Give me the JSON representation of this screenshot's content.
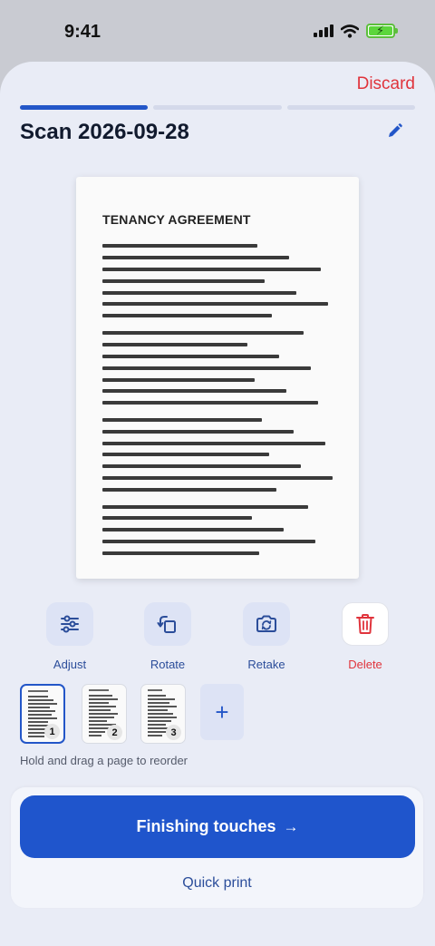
{
  "status_bar": {
    "time": "9:41"
  },
  "header": {
    "discard_label": "Discard",
    "title": "Scan 2026-09-28",
    "progress_steps": [
      {
        "active": true
      },
      {
        "active": false
      },
      {
        "active": false
      }
    ]
  },
  "document": {
    "heading": "TENANCY AGREEMENT"
  },
  "actions": [
    {
      "label": "Adjust",
      "icon": "sliders-icon"
    },
    {
      "label": "Rotate",
      "icon": "rotate-icon"
    },
    {
      "label": "Retake",
      "icon": "camera-retake-icon"
    },
    {
      "label": "Delete",
      "icon": "trash-icon"
    }
  ],
  "pages": [
    {
      "number": "1",
      "selected": true
    },
    {
      "number": "2",
      "selected": false
    },
    {
      "number": "3",
      "selected": false
    }
  ],
  "add_page_symbol": "+",
  "hint": "Hold and drag a page to reorder",
  "footer": {
    "primary_label": "Finishing touches",
    "primary_arrow": "→",
    "secondary_label": "Quick print"
  },
  "colors": {
    "accent": "#1f55cc",
    "danger": "#e0343c",
    "sheet_background": "#e9ecf6"
  }
}
